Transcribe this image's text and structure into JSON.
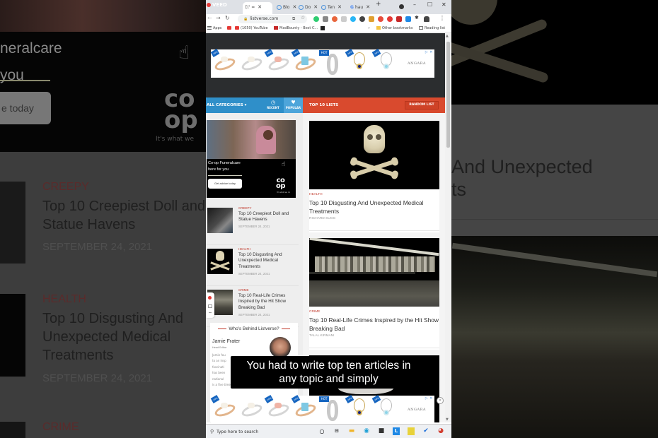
{
  "background": {
    "left": {
      "ad_title_lines": [
        "neralcare",
        "you"
      ],
      "ad_button": "e today",
      "ad_logo": "co op",
      "ad_tagline": "It's what we",
      "items": [
        {
          "category": "CREEPY",
          "title_lines": [
            "Top 10 Creepiest Doll and",
            "Statue Havens"
          ],
          "date": "SEPTEMBER 24, 2021"
        },
        {
          "category": "HEALTH",
          "title_lines": [
            "Top 10 Disgusting And",
            "Unexpected Medical",
            "Treatments"
          ],
          "date": "SEPTEMBER 24, 2021"
        },
        {
          "category": "CRIME"
        }
      ]
    },
    "right": {
      "title_lines": [
        "And Unexpected",
        "ts"
      ]
    }
  },
  "browser": {
    "tabs": [
      {
        "label": "[(' =",
        "active": true
      },
      {
        "label": "Blo"
      },
      {
        "label": "Do"
      },
      {
        "label": "Ten"
      },
      {
        "label": "hau"
      }
    ],
    "new_tab": "+",
    "window_controls": {
      "minimize": "–",
      "maximize": "☐",
      "close": "✕"
    },
    "url": "listverse.com",
    "bookmarks": [
      {
        "label": "Apps"
      },
      {
        "label": "(1050) YouTube"
      },
      {
        "label": "MadBounty - Best C..."
      },
      {
        "label": "Other bookmarks"
      },
      {
        "label": "Reading list"
      }
    ],
    "bookmarks_overflow": "»"
  },
  "page": {
    "top_ad": {
      "badges": [
        "-10%",
        "-10%",
        "-10%",
        "-10%",
        "HOT",
        "-10%",
        "-10%"
      ],
      "brand": "ANGARA",
      "adchoices": "▷ ✕"
    },
    "nav": {
      "all_categories": "ALL CATEGORIES ▾",
      "recent": "RECENT",
      "popular": "POPULAR",
      "top10": "TOP 10 LISTS",
      "random": "RANDOM LIST"
    },
    "sidebar_ad": {
      "title_lines": [
        "Co-op Funeralcare",
        "here for you"
      ],
      "button": "Get advice today",
      "logo_lines": [
        "co",
        "op"
      ],
      "tagline": "It's what we do"
    },
    "sidebar_items": [
      {
        "category": "CREEPY",
        "title": "Top 10 Creepiest Doll and Statue Havens",
        "date": "SEPTEMBER 24, 2021"
      },
      {
        "category": "HEALTH",
        "title": "Top 10 Disgusting And Unexpected Medical Treatments",
        "date": "SEPTEMBER 24, 2021"
      },
      {
        "category": "CRIME",
        "title": "Top 10 Real-Life Crimes Inspired by the Hit Show Breaking Bad",
        "date": "SEPTEMBER 24, 2021"
      }
    ],
    "who_behind": {
      "heading": "Who's Behind Listverse?",
      "name": "Jamie Frater",
      "role": "Head Editor",
      "bio_lines": [
        "Jamie fou",
        "to an insp",
        "fascinati",
        "has been",
        "national",
        "is a five time published author."
      ]
    },
    "main_cards": [
      {
        "category": "HEALTH",
        "title": "Top 10 Disgusting And Unexpected Medical Treatments",
        "author": "RICHARD SUGG"
      },
      {
        "category": "CRIME",
        "title": "Top 10 Real-Life Crimes Inspired by the Hit Show Breaking Bad",
        "author": "TALAL KIRMANI"
      }
    ],
    "bottom_ad": {
      "badges": [
        "-10%",
        "-10%",
        "-10%",
        "-10%",
        "HOT",
        "-10%",
        "-10%"
      ],
      "brand": "ANGARA",
      "adchoices": "▷ ✕",
      "close": "✕"
    }
  },
  "caption": {
    "lines": [
      "You had to write top ten articles in",
      "any topic and simply"
    ]
  },
  "taskbar": {
    "search_placeholder": "Type here to search"
  }
}
